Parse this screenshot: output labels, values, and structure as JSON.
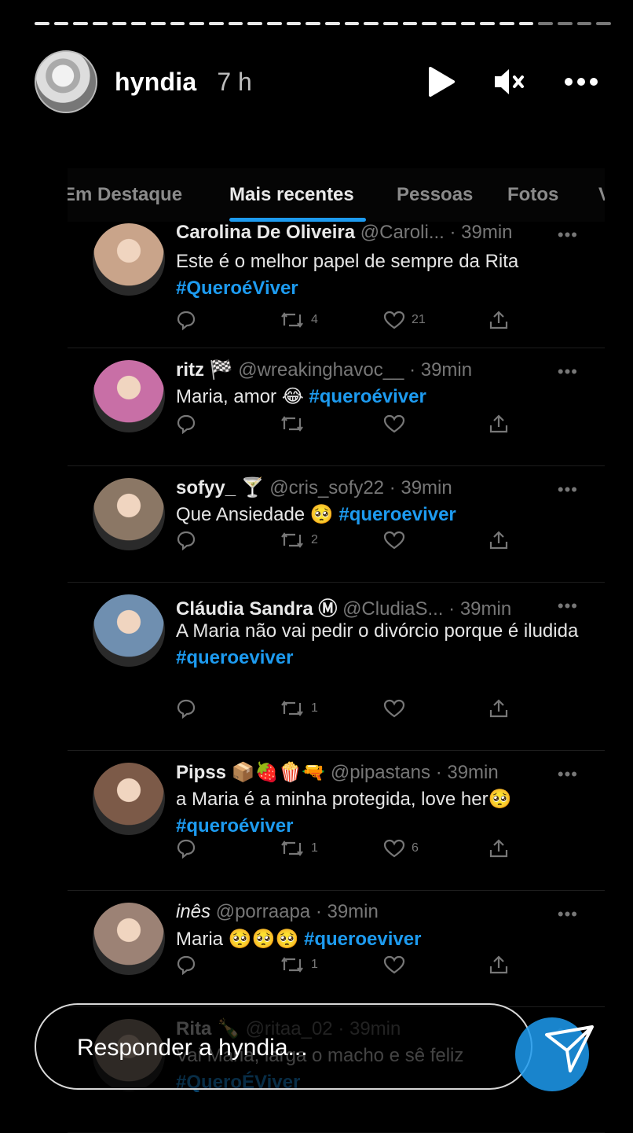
{
  "story": {
    "username": "hyndia",
    "time": "7 h",
    "progress_segments": 30,
    "progress_watched": 26,
    "icons": {
      "play": "play-icon",
      "mute": "mute-icon",
      "more": "more-options-icon"
    }
  },
  "tabs": [
    {
      "label": "Em Destaque",
      "active": false
    },
    {
      "label": "Mais recentes",
      "active": true
    },
    {
      "label": "Pessoas",
      "active": false
    },
    {
      "label": "Fotos",
      "active": false
    },
    {
      "label": "V",
      "active": false
    }
  ],
  "tweets": [
    {
      "name": "Carolina De Oliveira",
      "handle": "@Caroli...",
      "time": "· 39min",
      "text": "Este é o melhor papel de sempre da Rita",
      "hashtag": "#QueroéViver",
      "retweets": "4",
      "likes": "21",
      "avatar_color": "#c9a48a"
    },
    {
      "name": "ritz 🏁",
      "handle": "@wreakinghavoc__",
      "time": "· 39min",
      "text": "Maria, amor 😂",
      "hashtag": "#queroéviver",
      "retweets": "",
      "likes": "",
      "avatar_color": "#c86fa6"
    },
    {
      "name": "sofyy_ 🍸",
      "handle": "@cris_sofy22",
      "time": "· 39min",
      "text": "Que Ansiedade 🥺",
      "hashtag": "#queroeviver",
      "retweets": "2",
      "likes": "",
      "avatar_color": "#8b7765"
    },
    {
      "name": "Cláudia Sandra Ⓜ",
      "handle": "@CludiaS...",
      "time": "· 39min",
      "text": "A Maria não vai pedir o divórcio porque é iludida",
      "hashtag": "#queroeviver",
      "retweets": "1",
      "likes": "",
      "avatar_color": "#6f8fb0"
    },
    {
      "name": "Pipss 📦🍓🍿🔫",
      "handle": "@pipastans",
      "time": "· 39min",
      "text": "a Maria é a minha protegida, love her🥺",
      "hashtag": "#queroéviver",
      "retweets": "1",
      "likes": "6",
      "avatar_color": "#7c5a48"
    },
    {
      "name": "inês",
      "handle": "@porraapa",
      "time": "· 39min",
      "text": "Maria 🥺🥺🥺",
      "hashtag": "#queroeviver",
      "retweets": "1",
      "likes": "",
      "avatar_color": "#9c8275"
    },
    {
      "name": "Rita 🍾",
      "handle": "@ritaa_02",
      "time": "· 39min",
      "text": "Vai Maria, larga o macho e sê feliz",
      "hashtag": "#QueroÉViver",
      "retweets": "",
      "likes": "",
      "avatar_color": "#a08c80"
    }
  ],
  "reply": {
    "placeholder": "Responder a hyndia..."
  },
  "colors": {
    "accent": "#1d9bf0",
    "muted": "#777777"
  }
}
